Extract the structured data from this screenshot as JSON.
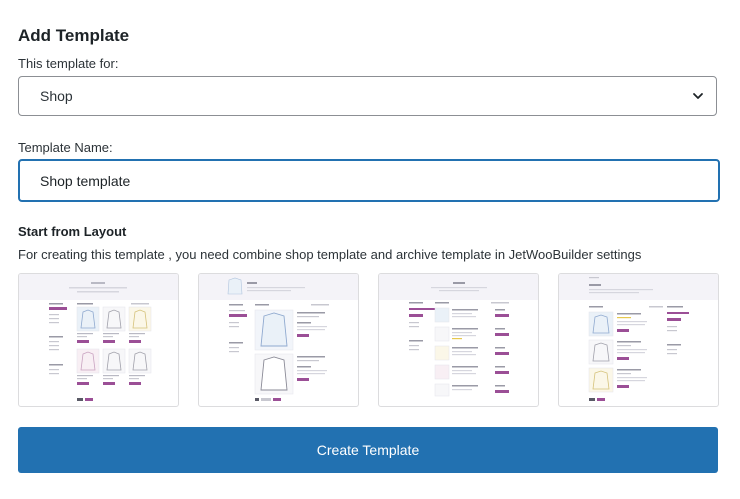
{
  "form": {
    "title": "Add Template",
    "template_for_label": "This template for:",
    "template_for_value": "Shop",
    "template_name_label": "Template Name:",
    "template_name_value": "Shop template",
    "layout_heading": "Start from Layout",
    "layout_description": "For creating this template , you need combine shop template and archive template in JetWooBuilder settings",
    "submit_label": "Create Template"
  },
  "colors": {
    "accent": "#2271b1",
    "preview_tag": "#9b4f96",
    "preview_header": "#f4f3f8"
  },
  "icons": {
    "select_arrow": "chevron-down-icon"
  }
}
